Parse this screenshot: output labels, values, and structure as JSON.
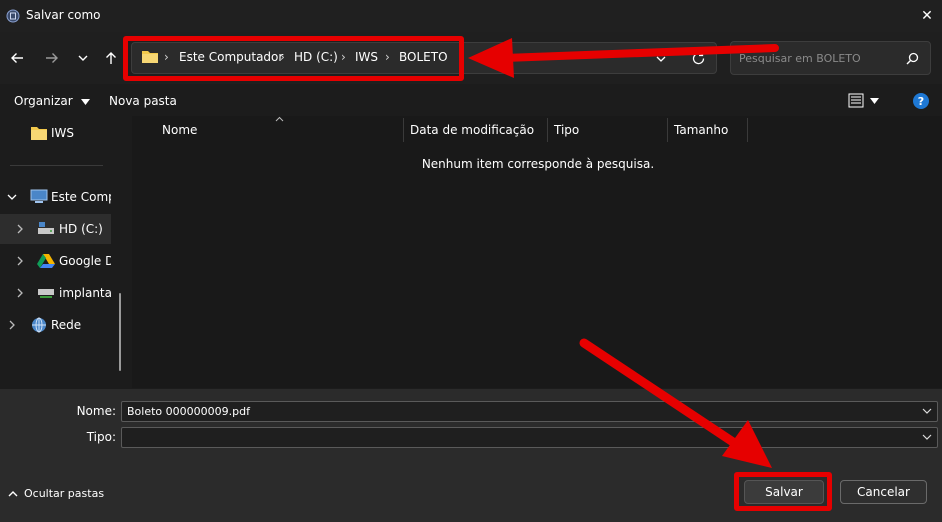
{
  "window": {
    "title": "Salvar como",
    "close_glyph": "✕"
  },
  "address": {
    "breadcrumbs": [
      "Este Computador",
      "HD (C:)",
      "IWS",
      "BOLETO"
    ],
    "separator": "›"
  },
  "search": {
    "placeholder": "Pesquisar em BOLETO"
  },
  "toolbar": {
    "organize_label": "Organizar",
    "new_folder_label": "Nova pasta"
  },
  "sidebar": {
    "items": [
      {
        "label": "IWS",
        "icon": "folder-icon"
      },
      {
        "label": "Este Computador",
        "icon": "computer-icon"
      },
      {
        "label": "HD (C:)",
        "icon": "drive-icon"
      },
      {
        "label": "Google Drive",
        "icon": "google-drive-icon"
      },
      {
        "label": "implantacao",
        "icon": "network-drive-icon"
      },
      {
        "label": "Rede",
        "icon": "network-icon"
      }
    ]
  },
  "file_list": {
    "columns": [
      "Nome",
      "Data de modificação",
      "Tipo",
      "Tamanho"
    ],
    "empty_message": "Nenhum item corresponde à pesquisa."
  },
  "form": {
    "name_label": "Nome:",
    "name_value": "Boleto 000000009.pdf",
    "type_label": "Tipo:",
    "type_value": ""
  },
  "footer": {
    "hide_folders_label": "Ocultar pastas",
    "save_label": "Salvar",
    "cancel_label": "Cancelar"
  },
  "colors": {
    "background": "#1c1c1c",
    "panel": "#2b2b2b",
    "annotation_red": "#e60000",
    "help_blue": "#1e78d4",
    "folder_yellow": "#f2c94c"
  }
}
